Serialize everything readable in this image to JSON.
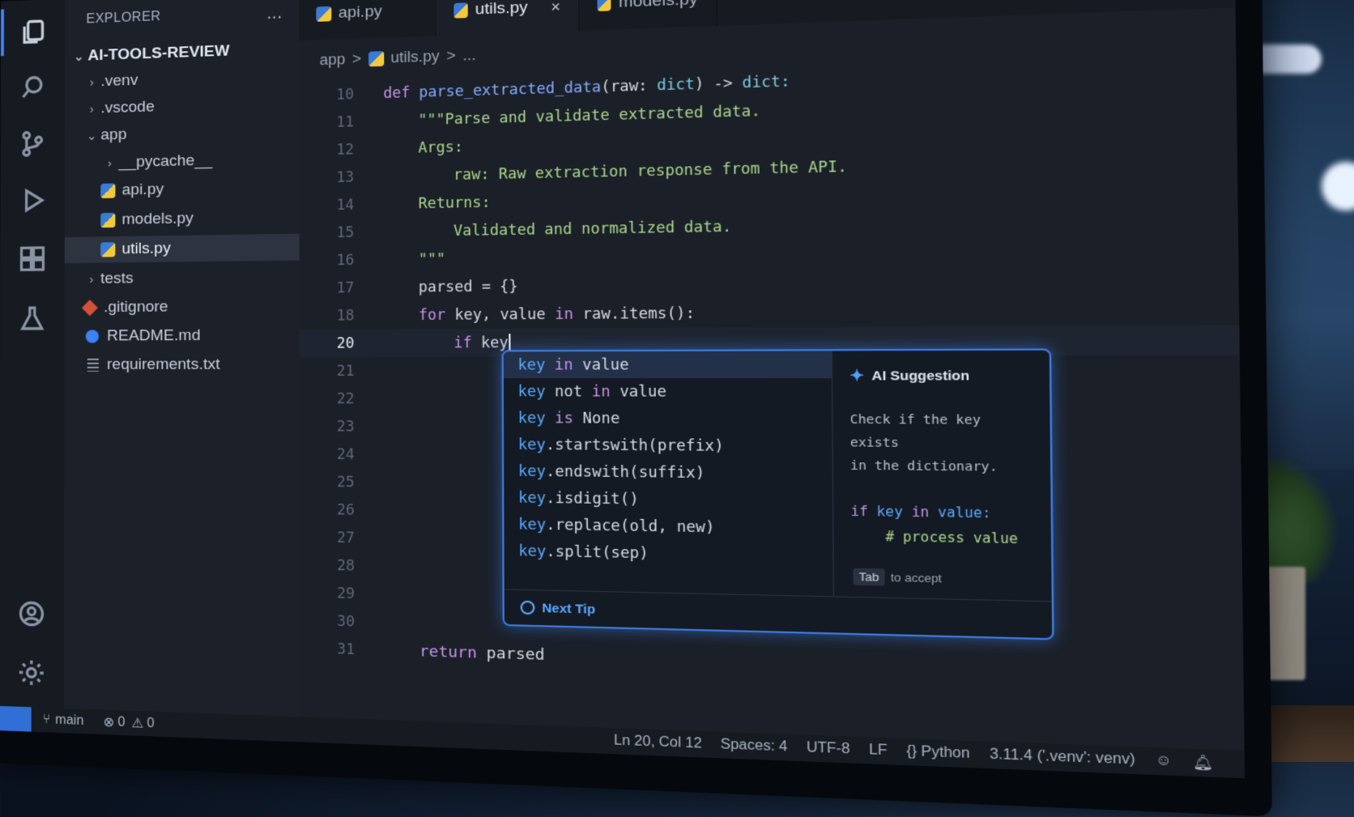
{
  "sidebar": {
    "title": "EXPLORER",
    "more": "...",
    "project": "AI-TOOLS-REVIEW",
    "items": [
      {
        "label": ".venv"
      },
      {
        "label": ".vscode"
      },
      {
        "label": "app"
      },
      {
        "label": "__pycache__"
      },
      {
        "label": "api.py"
      },
      {
        "label": "models.py"
      },
      {
        "label": "utils.py"
      },
      {
        "label": "tests"
      },
      {
        "label": ".gitignore"
      },
      {
        "label": "README.md"
      },
      {
        "label": "requirements.txt"
      }
    ]
  },
  "tabs": [
    {
      "label": "api.py"
    },
    {
      "label": "utils.py",
      "close": "×"
    },
    {
      "label": "models.py"
    }
  ],
  "breadcrumb": {
    "folder": "app",
    "file": "utils.py",
    "sep": ">",
    "more": "..."
  },
  "code": {
    "line_numbers": [
      "10",
      "11",
      "12",
      "13",
      "14",
      "15",
      "16",
      "17",
      "18",
      "20",
      "21",
      "22",
      "23",
      "24",
      "25",
      "26",
      "27",
      "28",
      "29",
      "30",
      "31"
    ],
    "l10": {
      "def": "def",
      "name": "parse_extracted_data",
      "params": "(raw: ",
      "type1": "dict",
      "arrow": ") -> ",
      "type2": "dict:"
    },
    "l11": "\"\"\"Parse and validate extracted data.",
    "l12": "Args:",
    "l13": "raw: Raw extraction response from the API.",
    "l14": "Returns:",
    "l15": "Validated and normalized data.",
    "l16": "\"\"\"",
    "l17": "parsed = {}",
    "l18": {
      "for": "for",
      "vars": " key, value ",
      "in": "in",
      "rest": " raw.items():"
    },
    "l20": {
      "if": "if",
      "rest": " key"
    },
    "l31": {
      "return": "return",
      "rest": " parsed"
    }
  },
  "suggest": {
    "items": [
      {
        "k": "key",
        "a": " ",
        "b": "in",
        "c": " value"
      },
      {
        "k": "key",
        "a": " not ",
        "b": "in",
        "c": " value"
      },
      {
        "k": "key",
        "a": " ",
        "b": "is",
        "c": " None"
      },
      {
        "k": "key",
        "a": ".startswith(prefix)",
        "b": "",
        "c": ""
      },
      {
        "k": "key",
        "a": ".endswith(suffix)",
        "b": "",
        "c": ""
      },
      {
        "k": "key",
        "a": ".isdigit()",
        "b": "",
        "c": ""
      },
      {
        "k": "key",
        "a": ".replace(old, new)",
        "b": "",
        "c": ""
      },
      {
        "k": "key",
        "a": ".split(sep)",
        "b": "",
        "c": ""
      }
    ],
    "detail_title": "AI Suggestion",
    "detail_desc1": "Check if the key exists",
    "detail_desc2": "in the dictionary.",
    "code_if": "if",
    "code_key": "key",
    "code_in": "in",
    "code_value": "value:",
    "code_comment": "# process value",
    "accept_key": "Tab",
    "accept_text": "to accept",
    "footer": "Next Tip"
  },
  "status": {
    "branch": "main",
    "errors": "0",
    "warnings": "0",
    "position": "Ln 20, Col 12",
    "spaces": "Spaces: 4",
    "encoding": "UTF-8",
    "eol": "LF",
    "language": "Python",
    "interpreter": "3.11.4 ('.venv': venv)"
  }
}
